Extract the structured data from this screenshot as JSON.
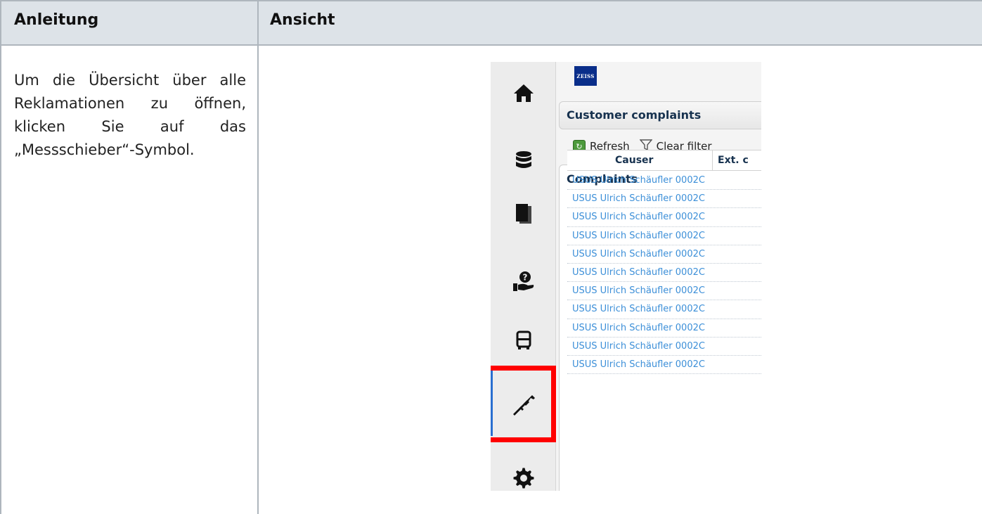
{
  "table": {
    "header": {
      "col1": "Anleitung",
      "col2": "Ansicht"
    },
    "instruction": "Um die Übersicht über alle Reklamationen zu öffnen, klicken Sie auf das „Messschieber“-Symbol."
  },
  "app": {
    "logo_text": "ZEISS",
    "panel_title": "Customer complaints",
    "toolbar": {
      "refresh_label": "Refresh",
      "clear_filter_label": "Clear filter"
    },
    "grid_title": "Complaints",
    "columns": [
      "Causer",
      "Ext. c"
    ],
    "rows": [
      "USUS Ulrich Schäufler 0002C",
      "USUS Ulrich Schäufler 0002C",
      "USUS Ulrich Schäufler 0002C",
      "USUS Ulrich Schäufler 0002C",
      "USUS Ulrich Schäufler 0002C",
      "USUS Ulrich Schäufler 0002C",
      "USUS Ulrich Schäufler 0002C",
      "USUS Ulrich Schäufler 0002C",
      "USUS Ulrich Schäufler 0002C",
      "USUS Ulrich Schäufler 0002C",
      "USUS Ulrich Schäufler 0002C"
    ],
    "sidebar": [
      {
        "icon": "home-icon"
      },
      {
        "icon": "database-icon"
      },
      {
        "icon": "documents-icon"
      },
      {
        "icon": "support-hand-icon"
      },
      {
        "icon": "truck-icon"
      },
      {
        "icon": "caliper-icon",
        "active": true,
        "highlighted": true
      },
      {
        "icon": "gear-icon"
      }
    ],
    "colors": {
      "highlight": "#ff0000",
      "link": "#3c8fd8",
      "header_bg": "#dde3e8",
      "logo_bg": "#0a2e8a"
    }
  }
}
